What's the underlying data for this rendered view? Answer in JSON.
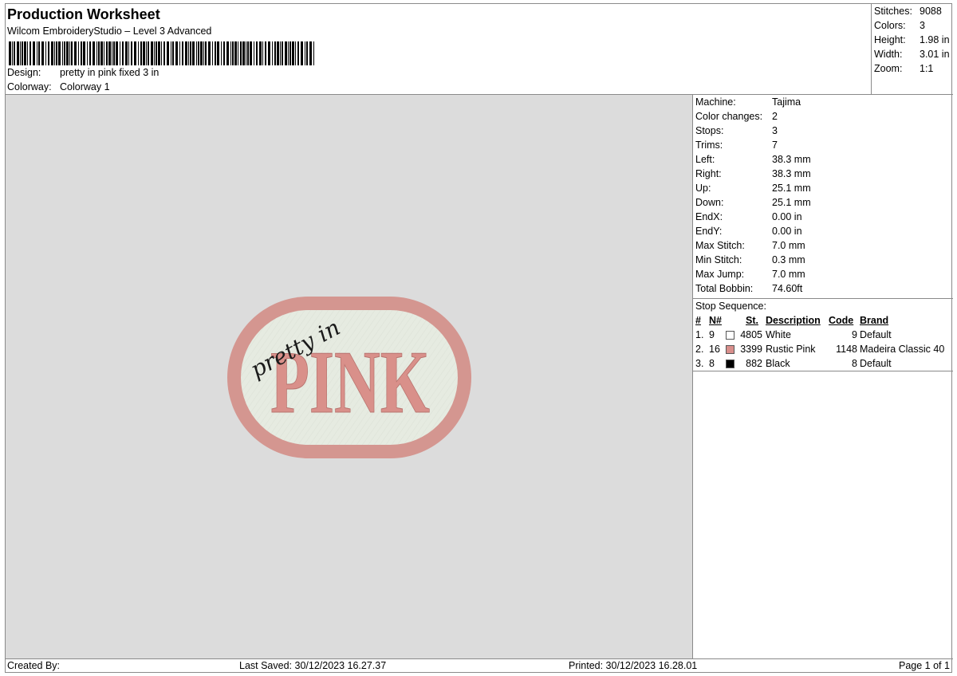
{
  "header": {
    "title": "Production Worksheet",
    "software": "Wilcom EmbroideryStudio – Level 3 Advanced",
    "design_label": "Design:",
    "design_value": "pretty in pink fixed 3 in",
    "colorway_label": "Colorway:",
    "colorway_value": "Colorway 1"
  },
  "summary": [
    {
      "label": "Stitches:",
      "value": "9088"
    },
    {
      "label": "Colors:",
      "value": "3"
    },
    {
      "label": "Height:",
      "value": "1.98 in"
    },
    {
      "label": "Width:",
      "value": "3.01 in"
    },
    {
      "label": "Zoom:",
      "value": "1:1"
    }
  ],
  "specs": [
    {
      "label": "Machine:",
      "value": "Tajima"
    },
    {
      "label": "Color changes:",
      "value": "2"
    },
    {
      "label": "Stops:",
      "value": "3"
    },
    {
      "label": "Trims:",
      "value": "7"
    },
    {
      "label": "Left:",
      "value": "38.3 mm"
    },
    {
      "label": "Right:",
      "value": "38.3 mm"
    },
    {
      "label": "Up:",
      "value": "25.1 mm"
    },
    {
      "label": "Down:",
      "value": "25.1 mm"
    },
    {
      "label": "EndX:",
      "value": "0.00 in"
    },
    {
      "label": "EndY:",
      "value": "0.00 in"
    },
    {
      "label": "Max Stitch:",
      "value": "7.0 mm"
    },
    {
      "label": "Min Stitch:",
      "value": "0.3 mm"
    },
    {
      "label": "Max Jump:",
      "value": "7.0 mm"
    },
    {
      "label": "Total Bobbin:",
      "value": "74.60ft"
    }
  ],
  "stop_sequence": {
    "heading": "Stop Sequence:",
    "columns": {
      "num": "#",
      "n": "N#",
      "st": "St.",
      "description": "Description",
      "code": "Code",
      "brand": "Brand"
    },
    "rows": [
      {
        "num": "1.",
        "n": "9",
        "color": "#ffffff",
        "st": "4805",
        "description": "White",
        "code": "9",
        "brand": "Default"
      },
      {
        "num": "2.",
        "n": "16",
        "color": "#d98f8c",
        "st": "3399",
        "description": "Rustic Pink",
        "code": "1148",
        "brand": "Madeira Classic 40"
      },
      {
        "num": "3.",
        "n": "8",
        "color": "#000000",
        "st": "882",
        "description": "Black",
        "code": "8",
        "brand": "Default"
      }
    ]
  },
  "design": {
    "script_text": "pretty in",
    "main_text": "PINK",
    "fill_color": "#e6ebe1",
    "border_color": "#d49690",
    "text_color": "#d9908a",
    "script_color": "#1a1a1a"
  },
  "footer": {
    "created_by": "Created By:",
    "last_saved": "Last Saved: 30/12/2023 16.27.37",
    "printed": "Printed: 30/12/2023 16.28.01",
    "page": "Page 1 of 1"
  }
}
